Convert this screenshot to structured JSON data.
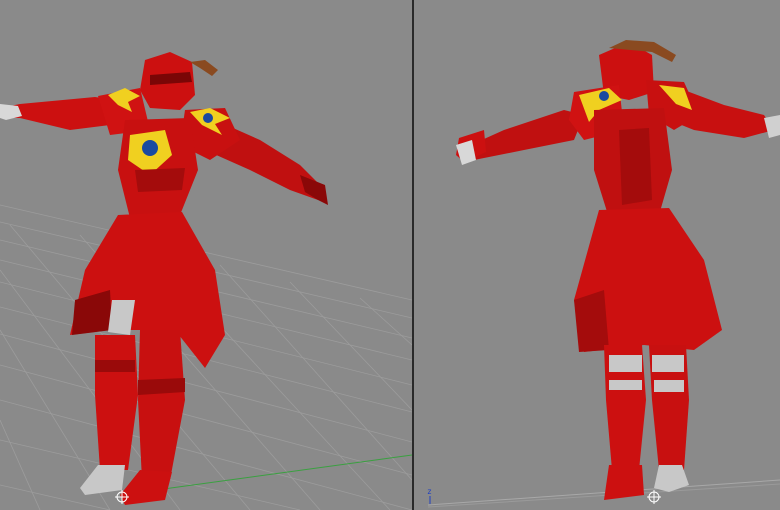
{
  "app": {
    "type": "3d-modeling-viewports"
  },
  "viewports": [
    {
      "id": "perspective",
      "view": "perspective",
      "grid": true,
      "subject": "red-armored-character-front-three-quarter"
    },
    {
      "id": "rear",
      "view": "orthographic",
      "grid": false,
      "subject": "red-armored-character-back",
      "axis_indicator": "z"
    }
  ],
  "colors": {
    "viewport_bg": "#8a8a8a",
    "grid": "#a0a0a0",
    "armor_red": "#cc1010",
    "armor_dark": "#7a0606",
    "trim_yellow": "#f0d020",
    "gem_blue": "#1a4aa0",
    "skin_grey": "#c8c8c8",
    "horn_brown": "#8a4a20",
    "divider": "#2a2a2a"
  }
}
